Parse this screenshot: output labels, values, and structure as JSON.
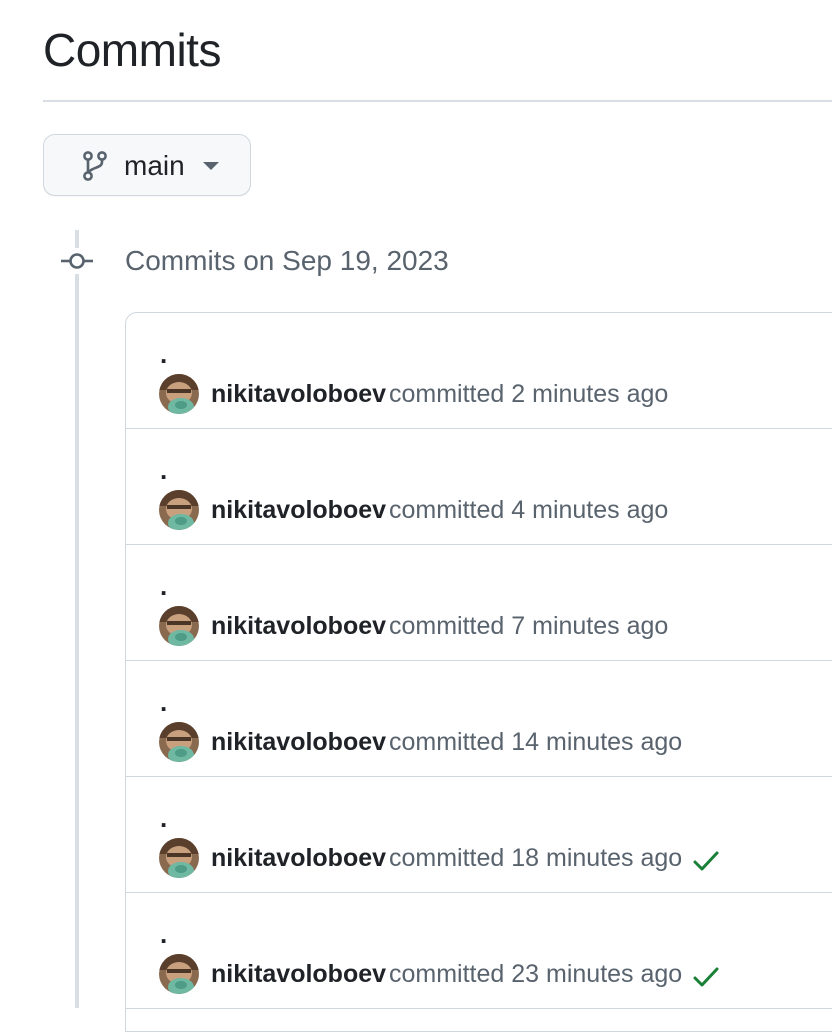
{
  "page": {
    "title": "Commits"
  },
  "branch": {
    "label": "main",
    "icon": "git-branch-icon"
  },
  "timeline": {
    "heading": "Commits on Sep 19, 2023",
    "icon": "git-commit-icon"
  },
  "colors": {
    "success": "#1a7f37",
    "muted_text": "#59636e",
    "border": "#d0d7de"
  },
  "commits": [
    {
      "message": ".",
      "author": "nikitavoloboev",
      "verb": "committed",
      "time": "2 minutes ago",
      "status": ""
    },
    {
      "message": ".",
      "author": "nikitavoloboev",
      "verb": "committed",
      "time": "4 minutes ago",
      "status": ""
    },
    {
      "message": ".",
      "author": "nikitavoloboev",
      "verb": "committed",
      "time": "7 minutes ago",
      "status": ""
    },
    {
      "message": ".",
      "author": "nikitavoloboev",
      "verb": "committed",
      "time": "14 minutes ago",
      "status": ""
    },
    {
      "message": ".",
      "author": "nikitavoloboev",
      "verb": "committed",
      "time": "18 minutes ago",
      "status": "success"
    },
    {
      "message": ".",
      "author": "nikitavoloboev",
      "verb": "committed",
      "time": "23 minutes ago",
      "status": "success"
    }
  ]
}
